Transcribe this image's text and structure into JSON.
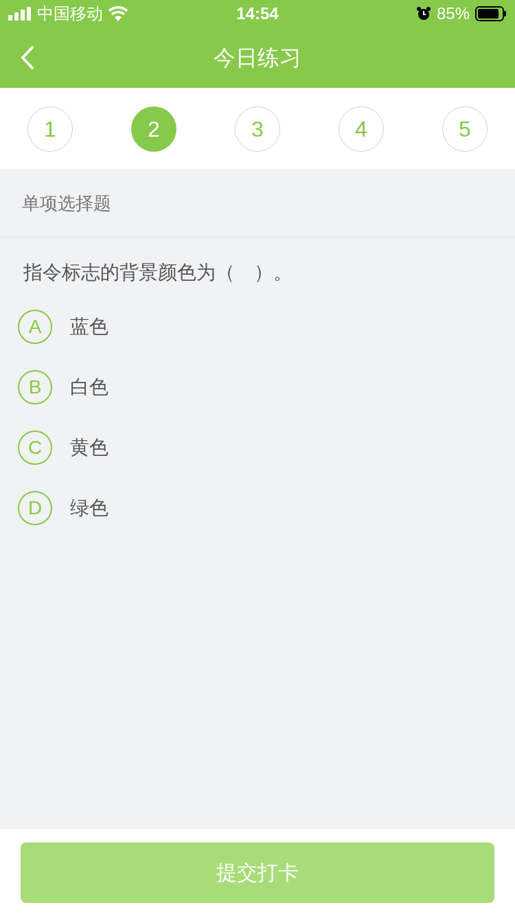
{
  "status_bar": {
    "carrier": "中国移动",
    "time": "14:54",
    "battery": "85%"
  },
  "nav": {
    "title": "今日练习"
  },
  "steps": [
    {
      "label": "1",
      "selected": false
    },
    {
      "label": "2",
      "selected": true
    },
    {
      "label": "3",
      "selected": false
    },
    {
      "label": "4",
      "selected": false
    },
    {
      "label": "5",
      "selected": false
    }
  ],
  "section_title": "单项选择题",
  "question": "指令标志的背景颜色为（　）。",
  "options": [
    {
      "letter": "A",
      "text": "蓝色",
      "selected": false
    },
    {
      "letter": "B",
      "text": "白色",
      "selected": false
    },
    {
      "letter": "C",
      "text": "黄色",
      "selected": false
    },
    {
      "letter": "D",
      "text": "绿色",
      "selected": false
    }
  ],
  "submit": {
    "label": "提交打卡",
    "disabled": true
  }
}
